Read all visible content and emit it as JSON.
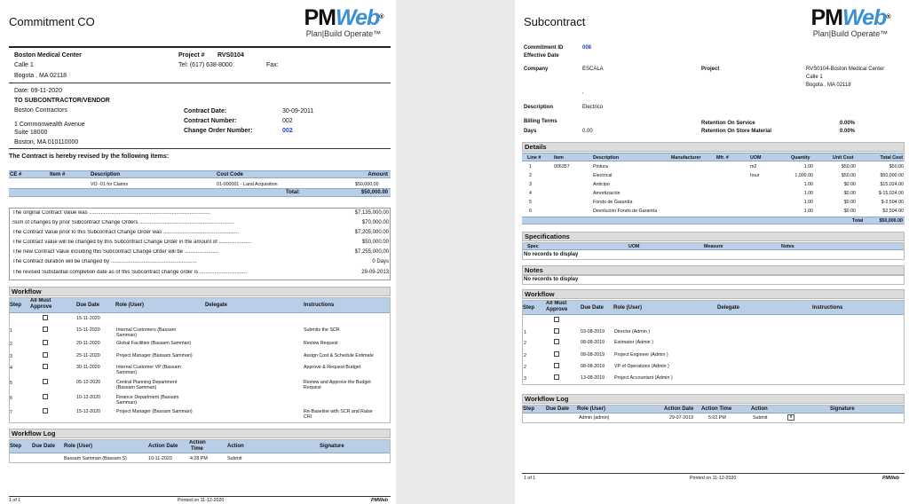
{
  "left": {
    "title": "Commitment CO",
    "logo": {
      "pm": "PM",
      "web": "Web",
      "tagline": "Plan|Build Operate™"
    },
    "owner": {
      "name": "Boston Medical Center",
      "addr1": "Calle 1",
      "addr2": "Bogota , MA 02118"
    },
    "project": {
      "label": "Project #",
      "number": "RVS0104",
      "tel": "Tel: (617) 638-8000",
      "fax_label": "Fax:"
    },
    "date": "Date: 09-11-2020",
    "to_label": "TO SUBCONTRACTOR/VENDOR",
    "vendor": {
      "name": "Boston Contractors",
      "addr1": "1 Commonwealth Avenue",
      "addr2": "Suite 18000",
      "addr3": "Boston, MA 010110000"
    },
    "contract": {
      "date_label": "Contract Date:",
      "date": "30-09-2011",
      "number_label": "Contract Number:",
      "number": "002",
      "co_label": "Change Order Number:",
      "co": "002"
    },
    "revised_text": "The Contract is hereby revised by the following items:",
    "items_headers": [
      "CE #",
      "Item #",
      "Description",
      "Cost Code",
      "Amount"
    ],
    "items": [
      {
        "ce": "",
        "item": "",
        "description": "VO -01 for Claims",
        "cost_code": "01-000001 - Land Acquisition",
        "amount": "$50,000.00"
      }
    ],
    "items_total_label": "Total:",
    "items_total": "$50,000.00",
    "summary": [
      {
        "text": "The original Contract Value was ..................................................................................",
        "value": "$7,135,000.00"
      },
      {
        "text": "Sum of changes by prior Subcontract Change Orders ................................................................",
        "value": "$70,000.00"
      },
      {
        "text": "The Contract Value prior to this Subcontract Change Order was ...................................................",
        "value": "$7,205,000.00"
      },
      {
        "text": "The Contract value will be changed by this Subcontract Change Order in the amount of ......................",
        "value": "$50,000.00"
      },
      {
        "text": "The new Contract Value including this Subcontract Change Order will be .......................",
        "value": "$7,255,000.00"
      },
      {
        "text": "The Contract duration will be changed by ..........................................................",
        "value": "0 Days"
      },
      {
        "text": "The revised Substantial completion date as  of this Subcontract change order is ................................",
        "value": "29-09-2013"
      }
    ],
    "workflow_title": "Workflow",
    "workflow_headers": {
      "step": "Step",
      "all_must": "All Must",
      "approve": "Approve",
      "due": "Due Date",
      "role": "Role (User)",
      "delegate": "Delegate",
      "instructions": "Instructions"
    },
    "workflow": [
      {
        "step": "",
        "due": "15-11-2020",
        "role1": "",
        "role2": "",
        "instr1": "",
        "instr2": ""
      },
      {
        "step": "1",
        "due": "15-11-2020",
        "role1": "Internal Customers (Bassam",
        "role2": "Samman)",
        "instr1": "Submits the SCR",
        "instr2": ""
      },
      {
        "step": "2",
        "due": "20-11-2020",
        "role1": "Global Facilities (Bassam Samman)",
        "role2": "",
        "instr1": "Review Request",
        "instr2": ""
      },
      {
        "step": "3",
        "due": "25-11-2020",
        "role1": "Project Manager (Bassam Samman)",
        "role2": "",
        "instr1": "Assign Cost & Schedule Estimate",
        "instr2": ""
      },
      {
        "step": "4",
        "due": "30-11-2020",
        "role1": "Internal Customer VP (Bassam",
        "role2": "Samman)",
        "instr1": "Approve & Request Budget",
        "instr2": ""
      },
      {
        "step": "5",
        "due": "05-12-2020",
        "role1": "Central Planning Department",
        "role2": "(Bassam Samman)",
        "instr1": "Review and Approve the Budget",
        "instr2": "Request"
      },
      {
        "step": "6",
        "due": "10-12-2020",
        "role1": "Finance Department (Bassam",
        "role2": "Samman)",
        "instr1": "",
        "instr2": ""
      },
      {
        "step": "7",
        "due": "15-12-2020",
        "role1": "Project Manager (Bassam Samman)",
        "role2": "",
        "instr1": "Re-Baseline with SCR and Raise",
        "instr2": "CRI"
      }
    ],
    "log_title": "Workflow Log",
    "log_headers": {
      "step": "Step",
      "due": "Due Date",
      "role": "Role (User)",
      "action_date": "Action Date",
      "action_time1": "Action",
      "action_time2": "Time",
      "action": "Action",
      "signature": "Signature"
    },
    "log": [
      {
        "role": "Bassam Samman (Bassam.S)",
        "action_date": "10-11-2020",
        "time": "4:28 PM",
        "action": "Submit"
      }
    ],
    "footer": {
      "page": "1 of 1",
      "printed": "Printed on 11-12-2020",
      "brand": "PMWeb"
    }
  },
  "right": {
    "title": "Subcontract",
    "logo": {
      "pm": "PM",
      "web": "Web",
      "tagline": "Plan|Build Operate™"
    },
    "commitment_id_label": "Commitment ID",
    "commitment_id": "008",
    "effective_label": "Effective Date",
    "company_label": "Company",
    "company": "ESCALA",
    "project_label": "Project",
    "project": {
      "line1": "RVS0104-Boston Medical Center",
      "line2": "Calle 1",
      "line3": "Bogota , MA 02118"
    },
    "comma": ",",
    "description_label": "Description",
    "description": "Electrico",
    "billing_label": "Billing Terms",
    "days_label": "Days",
    "days": "0.00",
    "retention_service_label": "Retention On Service",
    "retention_service": "0.00%",
    "retention_store_label": "Retention On Store Material",
    "retention_store": "0.00%",
    "details_title": "Details",
    "details_headers": [
      "Line #",
      "Item",
      "Description",
      "Manufacturer",
      "Mfr. #",
      "UOM",
      "Quantity",
      "Unit Cost",
      "Total Cost"
    ],
    "details": [
      {
        "line": "1",
        "item": "006357",
        "description": "Pintura",
        "uom": "m2",
        "qty": "1.00",
        "unit": "$50.00",
        "total": "$50.00"
      },
      {
        "line": "2",
        "item": "",
        "description": "Electrical",
        "uom": "hour",
        "qty": "1,000.00",
        "unit": "$50.00",
        "total": "$50,000.00"
      },
      {
        "line": "3",
        "item": "",
        "description": "Anticipo",
        "uom": "",
        "qty": "1.00",
        "unit": "$0.00",
        "total": "$15,024.00"
      },
      {
        "line": "4",
        "item": "",
        "description": "Amortización",
        "uom": "",
        "qty": "1.00",
        "unit": "$0.00",
        "total": "$-15,024.00"
      },
      {
        "line": "5",
        "item": "",
        "description": "Fondo de Garantía",
        "uom": "",
        "qty": "1.00",
        "unit": "$0.00",
        "total": "$-2,504.00"
      },
      {
        "line": "6",
        "item": "",
        "description": "Devolución Fondo de Garantía",
        "uom": "",
        "qty": "1.00",
        "unit": "$0.00",
        "total": "$2,504.00"
      }
    ],
    "details_total_label": "Total",
    "details_total": "$50,000.00",
    "spec_title": "Specifications",
    "spec_headers": [
      "Spec",
      "UOM",
      "Measure",
      "Notes"
    ],
    "no_records": "No records to display",
    "notes_title": "Notes",
    "workflow_title": "Workflow",
    "workflow_headers": {
      "step": "Step",
      "all_must": "All Must",
      "approve": "Approve",
      "due": "Due Date",
      "role": "Role (User)",
      "delegate": "Delegate",
      "instructions": "Instructions"
    },
    "workflow": [
      {
        "step": "",
        "due": "",
        "role": ""
      },
      {
        "step": "1",
        "due": "03-08-2019",
        "role": "Director (Admin )"
      },
      {
        "step": "2",
        "due": "08-08-2019",
        "role": "Estimator (Admin )"
      },
      {
        "step": "2",
        "due": "08-08-2019",
        "role": "Project Engineer (Admin )"
      },
      {
        "step": "2",
        "due": "08-08-2019",
        "role": "VP of Operations (Admin )"
      },
      {
        "step": "3",
        "due": "13-08-2019",
        "role": "Project Accountant (Admin )"
      }
    ],
    "log_title": "Workflow Log",
    "log_headers": {
      "step": "Step",
      "due": "Due Date",
      "role": "Role (User)",
      "action_date": "Action Date",
      "action_time": "Action Time",
      "action": "Action",
      "signature": "Signature"
    },
    "log": [
      {
        "role": "Admin  (admin)",
        "action_date": "29-07-2019",
        "time": "5:02 PM",
        "action": "Submit",
        "sig": "x"
      }
    ],
    "footer": {
      "page": "1 of 1",
      "printed": "Printed on 11-12-2020",
      "brand": "PMWeb"
    }
  }
}
